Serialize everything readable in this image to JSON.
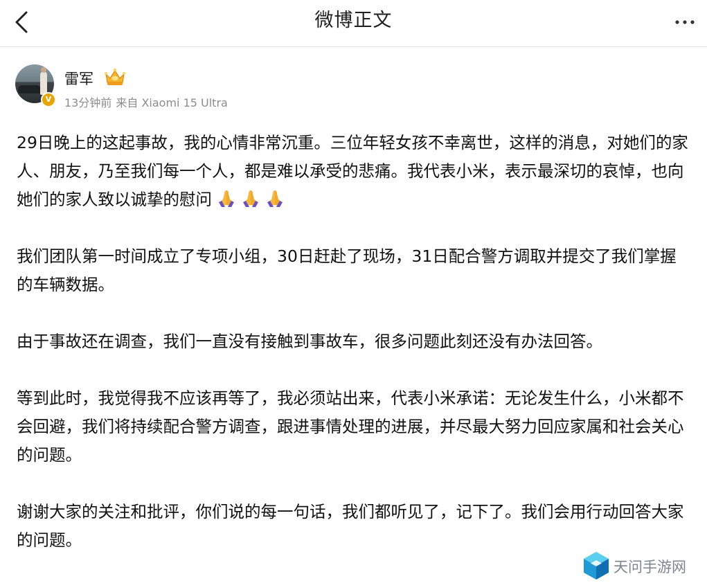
{
  "navbar": {
    "title": "微博正文",
    "back_icon": "chevron-left-icon",
    "more_icon": "more-horizontal-icon"
  },
  "author": {
    "name": "雷军",
    "verified_badge": "V",
    "badge_icon": "crown-icon",
    "time": "13分钟前",
    "source": "来自 Xiaomi 15 Ultra"
  },
  "post": {
    "paragraphs": [
      "29日晚上的这起事故，我的心情非常沉重。三位年轻女孩不幸离世，这样的消息，对她们的家人、朋友，乃至我们每一个人，都是难以承受的悲痛。我代表小米，表示最深切的哀悼，也向她们的家人致以诚挚的慰问",
      "我们团队第一时间成立了专项小组，30日赶赴了现场，31日配合警方调取并提交了我们掌握的车辆数据。",
      "由于事故还在调查，我们一直没有接触到事故车，很多问题此刻还没有办法回答。",
      "等到此时，我觉得我不应该再等了，我必须站出来，代表小米承诺：无论发生什么，小米都不会回避，我们将持续配合警方调查，跟进事情处理的进展，并尽最大努力回应家属和社会关心的问题。",
      "谢谢大家的关注和批评，你们说的每一句话，我们都听见了，记下了。我们会用行动回答大家的问题。"
    ],
    "emoji_icon": "folded-hands-icon",
    "emoji_count": 3
  },
  "watermark": {
    "text": "天问手游网",
    "logo_icon": "cube-logo-icon"
  },
  "colors": {
    "text": "#111111",
    "meta": "#8c8c8c",
    "badge": "#e8a400",
    "emoji": "#f5b83d",
    "emoji_sleeve": "#6b4fc8"
  }
}
